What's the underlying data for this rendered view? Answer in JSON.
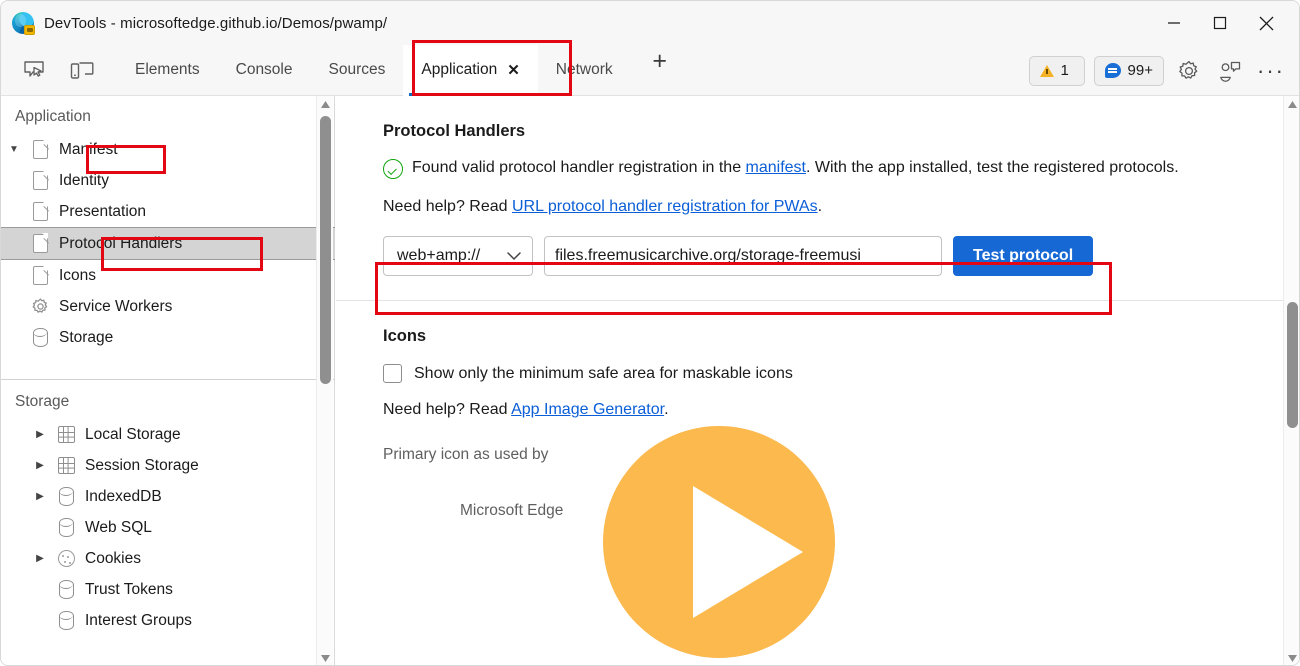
{
  "window": {
    "title": "DevTools - microsoftedge.github.io/Demos/pwamp/",
    "favicon": "edge-logo-icon",
    "controls": {
      "minimize": "minimize-icon",
      "maximize": "maximize-icon",
      "close": "close-icon"
    }
  },
  "toolbar": {
    "left_icons": [
      {
        "name": "inspect-element-icon"
      },
      {
        "name": "device-toolbar-icon"
      }
    ],
    "tabs": [
      {
        "label": "Elements",
        "active": false,
        "closable": false
      },
      {
        "label": "Console",
        "active": false,
        "closable": false
      },
      {
        "label": "Sources",
        "active": false,
        "closable": false
      },
      {
        "label": "Application",
        "active": true,
        "closable": true,
        "close_glyph": "✕"
      },
      {
        "label": "Network",
        "active": false,
        "closable": false
      }
    ],
    "add_tab_label": "+",
    "warnings_count": "1",
    "messages_count": "99+",
    "settings_icon": "gear-icon",
    "customize_icon": "issues-icon",
    "more_icon": "···"
  },
  "sidebar": {
    "top_section_title": "Application",
    "top_items": [
      {
        "label": "Manifest",
        "icon": "document-icon",
        "indent": 0,
        "twisty": "▼",
        "selected": false,
        "highlighted": true
      },
      {
        "label": "Identity",
        "icon": "document-icon",
        "indent": 1,
        "twisty": "",
        "selected": false,
        "highlighted": false
      },
      {
        "label": "Presentation",
        "icon": "document-icon",
        "indent": 1,
        "twisty": "",
        "selected": false,
        "highlighted": false
      },
      {
        "label": "Protocol Handlers",
        "icon": "document-icon",
        "indent": 1,
        "twisty": "",
        "selected": true,
        "highlighted": true
      },
      {
        "label": "Icons",
        "icon": "document-icon",
        "indent": 1,
        "twisty": "",
        "selected": false,
        "highlighted": false
      },
      {
        "label": "Service Workers",
        "icon": "gear-icon",
        "indent": 0,
        "twisty": "",
        "selected": false,
        "highlighted": false
      },
      {
        "label": "Storage",
        "icon": "database-icon",
        "indent": 0,
        "twisty": "",
        "selected": false,
        "highlighted": false
      }
    ],
    "bottom_section_title": "Storage",
    "bottom_items": [
      {
        "label": "Local Storage",
        "icon": "grid-icon",
        "twisty": "▶"
      },
      {
        "label": "Session Storage",
        "icon": "grid-icon",
        "twisty": "▶"
      },
      {
        "label": "IndexedDB",
        "icon": "database-icon",
        "twisty": "▶"
      },
      {
        "label": "Web SQL",
        "icon": "database-icon",
        "twisty": ""
      },
      {
        "label": "Cookies",
        "icon": "cookie-icon",
        "twisty": "▶"
      },
      {
        "label": "Trust Tokens",
        "icon": "database-icon",
        "twisty": ""
      },
      {
        "label": "Interest Groups",
        "icon": "database-icon",
        "twisty": ""
      }
    ]
  },
  "main": {
    "protocol_handlers": {
      "heading": "Protocol Handlers",
      "status_text_before_link": "Found valid protocol handler registration in the ",
      "status_link": "manifest",
      "status_text_after_link": ". With the app installed, test the registered protocols.",
      "help_prefix": "Need help? Read ",
      "help_link": "URL protocol handler registration for PWAs",
      "help_suffix": ".",
      "scheme_value": "web+amp://",
      "scheme_chevron": "⌄",
      "url_value": "files.freemusicarchive.org/storage-freemusi",
      "test_button": "Test protocol"
    },
    "icons_section": {
      "heading": "Icons",
      "checkbox_label": "Show only the minimum safe area for maskable icons",
      "checkbox_checked": false,
      "help_prefix": "Need help? Read ",
      "help_link": "App Image Generator",
      "help_suffix": ".",
      "preview_label_line1": "Primary icon as used by",
      "preview_label_line2": "Microsoft Edge",
      "preview_icon_name": "play-button-icon",
      "preview_icon_color": "#FBB94E"
    }
  },
  "colors": {
    "accent_blue": "#1668d4",
    "tab_underline": "#0f6cbd",
    "link": "#0b5ed7",
    "annotation_red": "#e30613",
    "success_green": "#12a60e",
    "icon_orange": "#FBB94E"
  }
}
